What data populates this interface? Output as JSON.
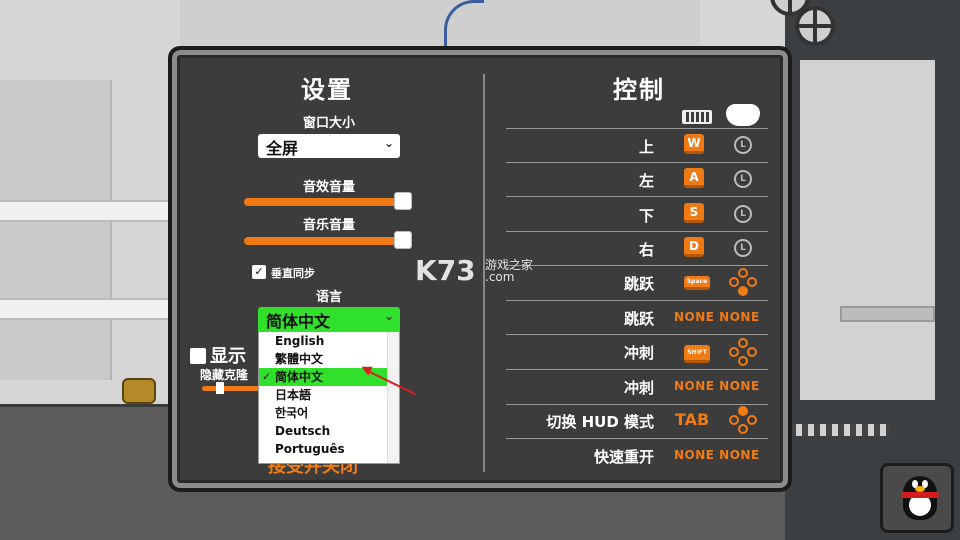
{
  "settings": {
    "title": "设置",
    "window_size_label": "窗口大小",
    "window_size_value": "全屏",
    "sfx_volume_label": "音效音量",
    "sfx_volume_level": 0.95,
    "music_volume_label": "音乐音量",
    "music_volume_level": 0.95,
    "vsync_label": "垂直同步",
    "vsync_checked": true,
    "language_label": "语言",
    "language_value": "简体中文",
    "language_options": [
      "English",
      "繁體中文",
      "简体中文",
      "日本語",
      "한국어",
      "Deutsch",
      "Português"
    ],
    "language_selected_index": 2,
    "show_label": "显示",
    "hide_clone_label": "隐藏克隆",
    "accept_label": "接受并关闭"
  },
  "controls": {
    "title": "控制",
    "rows": [
      {
        "label": "上",
        "key": "W",
        "pad": "stick-up"
      },
      {
        "label": "左",
        "key": "A",
        "pad": "stick-left"
      },
      {
        "label": "下",
        "key": "S",
        "pad": "stick-down"
      },
      {
        "label": "右",
        "key": "D",
        "pad": "stick-right"
      },
      {
        "label": "跳跃",
        "key": "Space",
        "pad": "buttons"
      },
      {
        "label": "跳跃",
        "key": "NONE",
        "pad": "NONE"
      },
      {
        "label": "冲刺",
        "key": "SHIFT",
        "pad": "buttons"
      },
      {
        "label": "冲刺",
        "key": "NONE",
        "pad": "NONE"
      },
      {
        "label": "切换 HUD 模式",
        "key": "TAB",
        "pad": "buttons"
      },
      {
        "label": "快速重开",
        "key": "NONE",
        "pad": "NONE"
      }
    ]
  },
  "watermark": {
    "logo": "K73",
    "subtitle": "游戏之家",
    "domain": ".com"
  },
  "colors": {
    "accent": "#f07a14",
    "highlight": "#31e02a",
    "panel": "#3c3c3c"
  }
}
